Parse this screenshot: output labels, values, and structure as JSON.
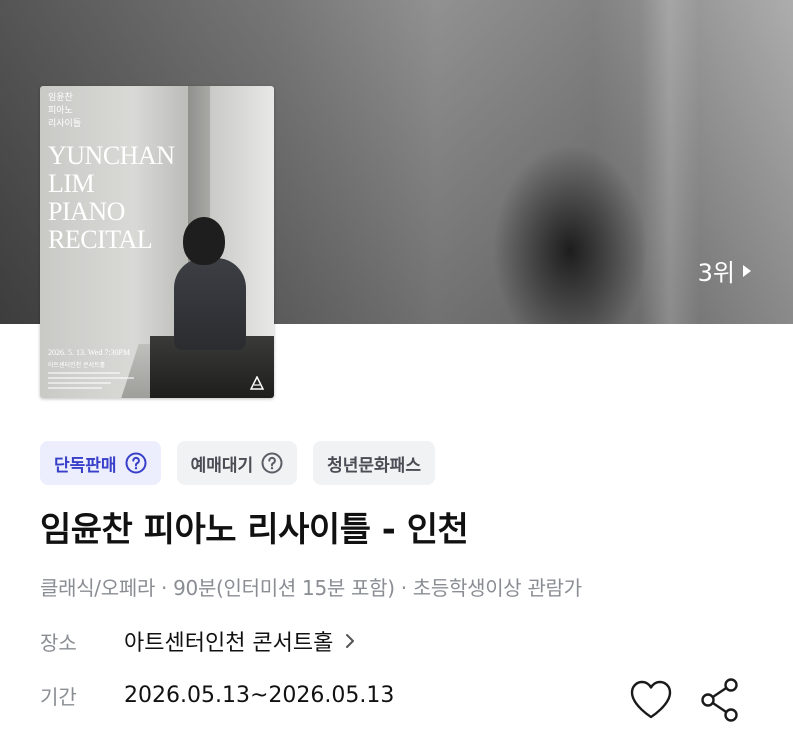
{
  "hero": {
    "rank_label": "3위"
  },
  "poster": {
    "ko_lines": [
      "임윤찬",
      "피아노",
      "리사이틀"
    ],
    "title_en": "YUNCHAN\nLIM\nPIANO\nRECITAL",
    "date": "2026. 5. 13. Wed 7:30PM",
    "venue": "아트센터인천 콘서트홀"
  },
  "badges": [
    {
      "label": "단독판매",
      "icon": "question-circle-icon",
      "color": "#3840c9"
    },
    {
      "label": "예매대기",
      "icon": "question-circle-icon",
      "color": "#4a4d55"
    },
    {
      "label": "청년문화패스"
    }
  ],
  "event": {
    "title": "임윤찬 피아노 리사이틀 - 인천",
    "genre": "클래식/오페라",
    "duration": "90분(인터미션 15분 포함)",
    "age": "초등학생이상 관람가"
  },
  "details": {
    "venue_label": "장소",
    "venue_value": "아트센터인천 콘서트홀",
    "period_label": "기간",
    "period_value": "2026.05.13~2026.05.13"
  },
  "actions": {
    "like_icon": "heart-icon",
    "share_icon": "share-icon"
  },
  "colors": {
    "accent": "#3840c9",
    "badge_bg": "#f1f2f4",
    "badge_primary_bg": "#eceefd",
    "meta_text": "#8a8d93"
  }
}
